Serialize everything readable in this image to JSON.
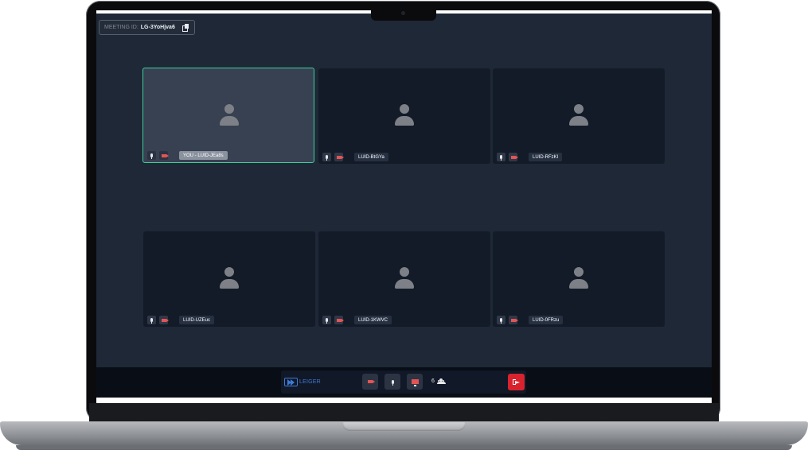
{
  "meeting": {
    "id_label": "MEETING ID:",
    "id_value": "LG-3YoHjva6"
  },
  "participants": [
    {
      "name": "YOU - LUID-JEa8s",
      "is_self": true,
      "mic": "on",
      "camera": "off"
    },
    {
      "name": "LUID-BtGYa",
      "is_self": false,
      "mic": "on",
      "camera": "off"
    },
    {
      "name": "LUID-RFzKl",
      "is_self": false,
      "mic": "on",
      "camera": "off"
    },
    {
      "name": "LUID-UZEuc",
      "is_self": false,
      "mic": "on",
      "camera": "off"
    },
    {
      "name": "LUID-1KWVC",
      "is_self": false,
      "mic": "on",
      "camera": "off"
    },
    {
      "name": "LUID-0FRzu",
      "is_self": false,
      "mic": "on",
      "camera": "off"
    }
  ],
  "toolbar": {
    "logo_text": "LEIGER",
    "participant_count": "6",
    "buttons": [
      "camera-off",
      "microphone",
      "share-screen",
      "leave"
    ]
  },
  "colors": {
    "background": "#1e2837",
    "tile": "#141b28",
    "self_tile": "#374151",
    "self_border": "#3ecf9b",
    "accent": "#3e7bd6",
    "danger": "#d8232f"
  }
}
